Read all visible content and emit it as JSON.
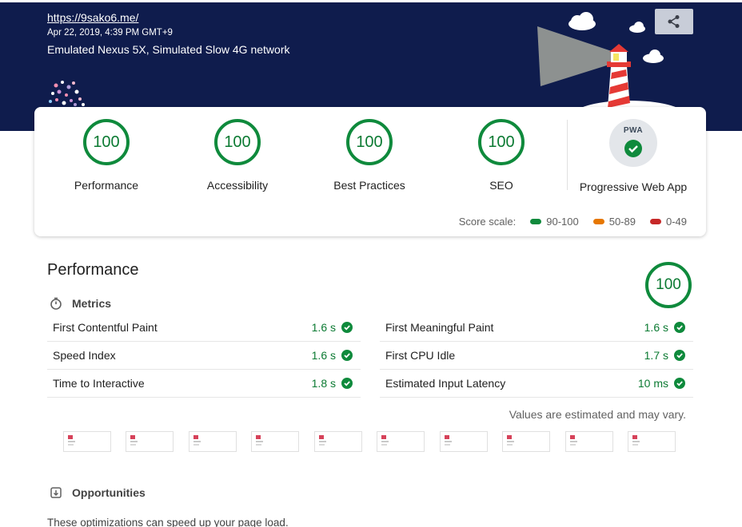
{
  "header": {
    "url": "https://9sako6.me/",
    "date": "Apr 22, 2019, 4:39 PM GMT+9",
    "environment": "Emulated Nexus 5X, Simulated Slow 4G network",
    "share_icon": "share-icon"
  },
  "scores": [
    {
      "value": "100",
      "label": "Performance"
    },
    {
      "value": "100",
      "label": "Accessibility"
    },
    {
      "value": "100",
      "label": "Best Practices"
    },
    {
      "value": "100",
      "label": "SEO"
    }
  ],
  "pwa": {
    "badge": "PWA",
    "label": "Progressive Web App"
  },
  "scale": {
    "label": "Score scale:",
    "items": [
      {
        "range": "90-100",
        "color": "#0f8a3c"
      },
      {
        "range": "50-89",
        "color": "#e67700"
      },
      {
        "range": "0-49",
        "color": "#c62828"
      }
    ]
  },
  "performance": {
    "title": "Performance",
    "score": "100",
    "metrics_heading": "Metrics",
    "metrics": [
      {
        "name": "First Contentful Paint",
        "value": "1.6 s"
      },
      {
        "name": "First Meaningful Paint",
        "value": "1.6 s"
      },
      {
        "name": "Speed Index",
        "value": "1.6 s"
      },
      {
        "name": "First CPU Idle",
        "value": "1.7 s"
      },
      {
        "name": "Time to Interactive",
        "value": "1.8 s"
      },
      {
        "name": "Estimated Input Latency",
        "value": "10 ms"
      }
    ],
    "note": "Values are estimated and may vary.",
    "opportunities_heading": "Opportunities",
    "opportunities_desc": "These optimizations can speed up your page load."
  },
  "colors": {
    "header_bg": "#0f1c4d",
    "pass": "#0f8a3c"
  }
}
